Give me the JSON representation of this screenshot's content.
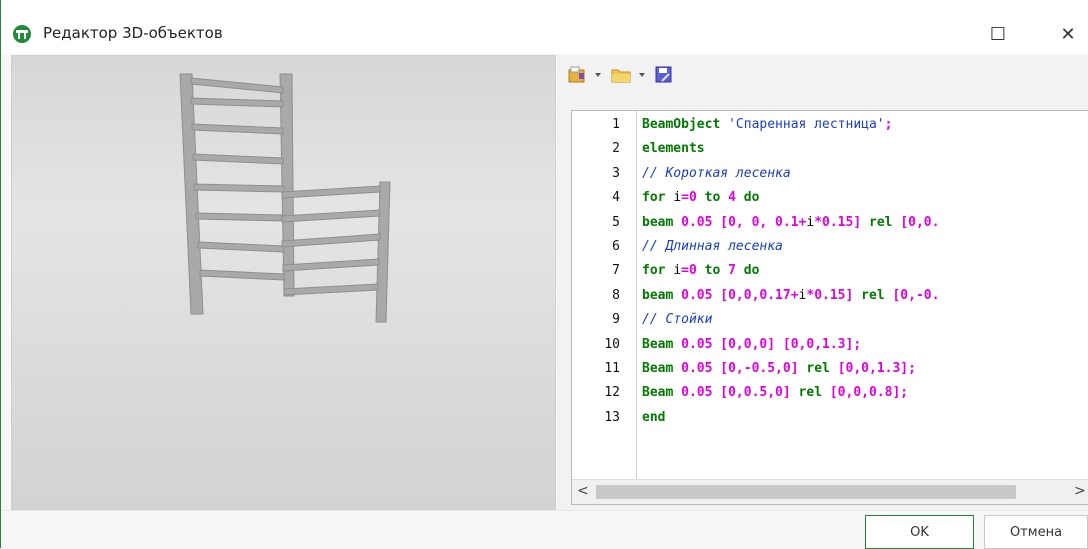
{
  "window": {
    "title": "Редактор 3D-объектов",
    "maximize_glyph": "☐",
    "close_glyph": "✕"
  },
  "toolbar": {
    "items": [
      "template-icon",
      "open-folder-icon",
      "save-icon"
    ]
  },
  "editor": {
    "line_numbers": [
      "1",
      "2",
      "3",
      "4",
      "5",
      "6",
      "7",
      "8",
      "9",
      "10",
      "11",
      "12",
      "13"
    ],
    "lines": [
      [
        {
          "t": "BeamObject ",
          "c": "kw"
        },
        {
          "t": "'Спаренная лестница'",
          "c": "str"
        },
        {
          "t": ";",
          "c": "num"
        }
      ],
      [
        {
          "t": "elements",
          "c": "kw"
        }
      ],
      [
        {
          "t": "// Короткая лесенка",
          "c": "cmt"
        }
      ],
      [
        {
          "t": "for ",
          "c": "kw"
        },
        {
          "t": "i",
          "c": "id"
        },
        {
          "t": "=0 ",
          "c": "num"
        },
        {
          "t": "to ",
          "c": "kw"
        },
        {
          "t": "4 ",
          "c": "num"
        },
        {
          "t": "do",
          "c": "kw"
        }
      ],
      [
        {
          "t": "beam ",
          "c": "kw"
        },
        {
          "t": "0.05 [0, 0, 0.1+",
          "c": "num"
        },
        {
          "t": "i",
          "c": "id"
        },
        {
          "t": "*0.15] ",
          "c": "num"
        },
        {
          "t": "rel ",
          "c": "kw"
        },
        {
          "t": "[0,0.",
          "c": "num"
        }
      ],
      [
        {
          "t": "// Длинная лесенка",
          "c": "cmt"
        }
      ],
      [
        {
          "t": "for ",
          "c": "kw"
        },
        {
          "t": "i",
          "c": "id"
        },
        {
          "t": "=0 ",
          "c": "num"
        },
        {
          "t": "to ",
          "c": "kw"
        },
        {
          "t": "7 ",
          "c": "num"
        },
        {
          "t": "do",
          "c": "kw"
        }
      ],
      [
        {
          "t": "beam ",
          "c": "kw"
        },
        {
          "t": "0.05 [0,0,0.17+",
          "c": "num"
        },
        {
          "t": "i",
          "c": "id"
        },
        {
          "t": "*0.15] ",
          "c": "num"
        },
        {
          "t": "rel ",
          "c": "kw"
        },
        {
          "t": "[0,-0.",
          "c": "num"
        }
      ],
      [
        {
          "t": "// Стойки",
          "c": "cmt"
        }
      ],
      [
        {
          "t": "Beam ",
          "c": "kw"
        },
        {
          "t": "0.05 [0,0,0] [0,0,1.3];",
          "c": "num"
        }
      ],
      [
        {
          "t": "Beam ",
          "c": "kw"
        },
        {
          "t": "0.05 [0,-0.5,0] ",
          "c": "num"
        },
        {
          "t": "rel ",
          "c": "kw"
        },
        {
          "t": "[0,0,1.3];",
          "c": "num"
        }
      ],
      [
        {
          "t": "Beam ",
          "c": "kw"
        },
        {
          "t": "0.05 [0,0.5,0] ",
          "c": "num"
        },
        {
          "t": "rel ",
          "c": "kw"
        },
        {
          "t": "[0,0,0.8];",
          "c": "num"
        }
      ],
      [
        {
          "t": "end",
          "c": "kw"
        }
      ]
    ]
  },
  "scroll": {
    "left_glyph": "<",
    "right_glyph": ">"
  },
  "buttons": {
    "ok": "OK",
    "cancel": "Отмена"
  },
  "colors": {
    "accent": "#1f8a3a",
    "keyword": "#007a00",
    "number": "#e000e0",
    "comment": "#1a3dc8"
  }
}
